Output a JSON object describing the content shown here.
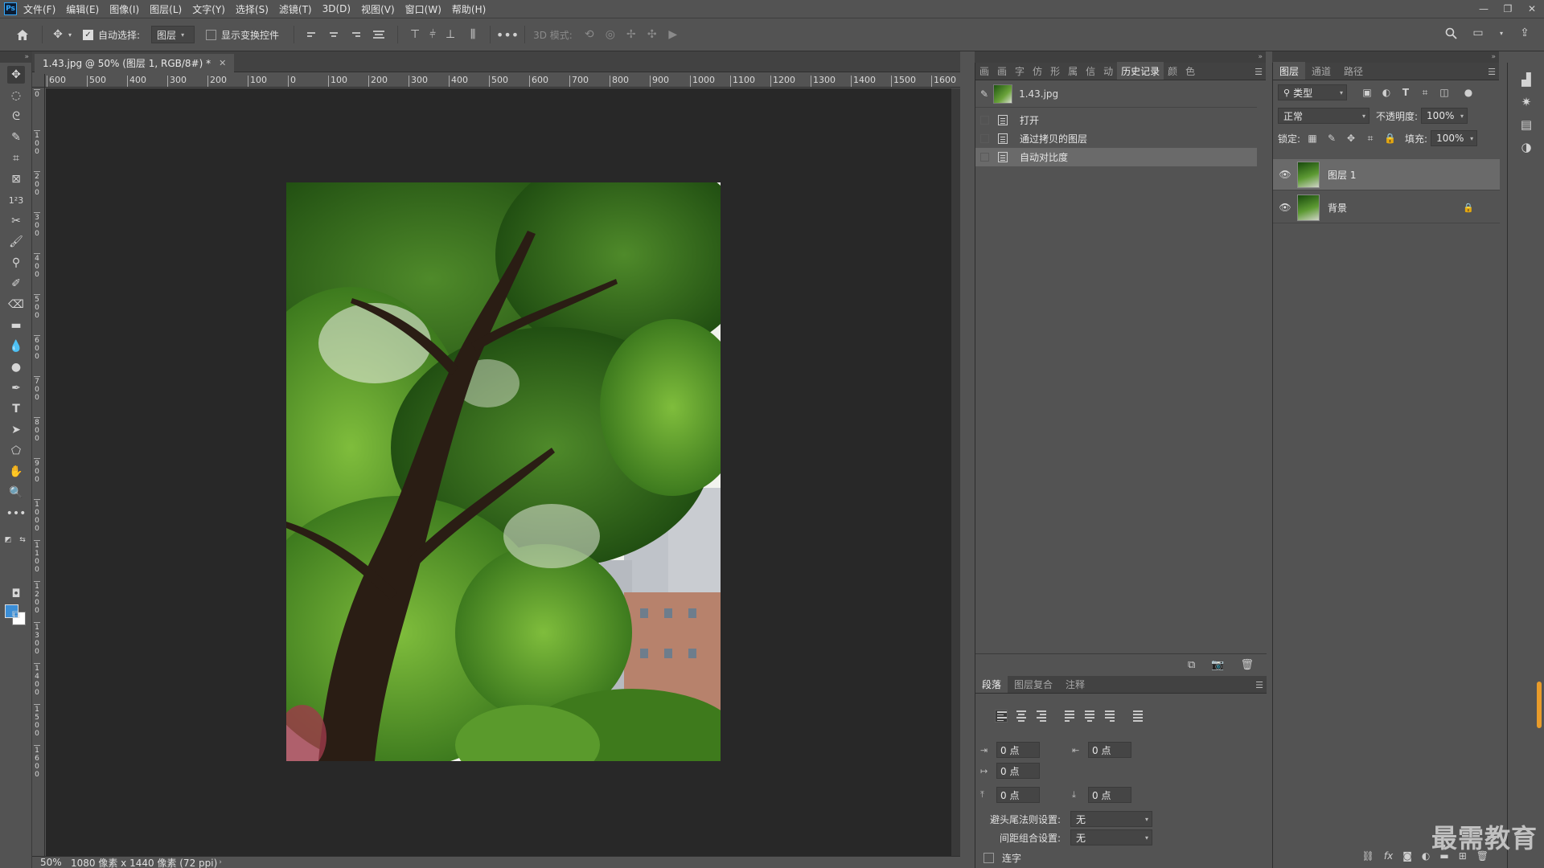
{
  "menubar": {
    "items": [
      "文件(F)",
      "编辑(E)",
      "图像(I)",
      "图层(L)",
      "文字(Y)",
      "选择(S)",
      "滤镜(T)",
      "3D(D)",
      "视图(V)",
      "窗口(W)",
      "帮助(H)"
    ]
  },
  "optbar": {
    "auto_select_label": "自动选择:",
    "auto_select_value": "图层",
    "show_transform_label": "显示变换控件",
    "mode_3d_label": "3D 模式:"
  },
  "document": {
    "tab_title": "1.43.jpg @ 50% (图层 1, RGB/8#) *",
    "ruler_h_labels": [
      "600",
      "500",
      "400",
      "300",
      "200",
      "100",
      "0",
      "100",
      "200",
      "300",
      "400",
      "500",
      "600",
      "700",
      "800",
      "900",
      "1000",
      "1100",
      "1200",
      "1300",
      "1400",
      "1500",
      "1600"
    ],
    "ruler_v_labels": [
      "0",
      "100",
      "200",
      "300",
      "400",
      "500",
      "600",
      "700",
      "800",
      "900",
      "1000",
      "1100",
      "1200",
      "1300",
      "1400",
      "1500",
      "1600"
    ],
    "status": {
      "zoom": "50%",
      "info": "1080 像素 x 1440 像素 (72 ppi)"
    }
  },
  "history_panel": {
    "tabs": [
      "画",
      "画",
      "字",
      "仿",
      "形",
      "属",
      "信",
      "动",
      "历史记录",
      "颜",
      "色"
    ],
    "snapshot_name": "1.43.jpg",
    "items": [
      "打开",
      "通过拷贝的图层",
      "自动对比度"
    ]
  },
  "paragraph_panel": {
    "tabs": [
      "段落",
      "图层复合",
      "注释"
    ],
    "indent_left": "0 点",
    "indent_right": "0 点",
    "indent_first": "0 点",
    "space_before": "0 点",
    "space_after": "0 点",
    "kinsoku_label": "避头尾法则设置:",
    "kinsoku_value": "无",
    "mojikumi_label": "间距组合设置:",
    "mojikumi_value": "无",
    "hyphenate_label": "连字"
  },
  "layers_panel": {
    "tabs": [
      "图层",
      "通道",
      "路径"
    ],
    "filter_kind": "类型",
    "blend_mode": "正常",
    "opacity_label": "不透明度:",
    "opacity_value": "100%",
    "lock_label": "锁定:",
    "fill_label": "填充:",
    "fill_value": "100%",
    "layers": [
      {
        "name": "图层 1"
      },
      {
        "name": "背景"
      }
    ]
  },
  "watermark": "最需教育",
  "colors": {
    "foreground": "#3b8ed6",
    "background": "#ffffff",
    "accent": "#e89b2a"
  }
}
